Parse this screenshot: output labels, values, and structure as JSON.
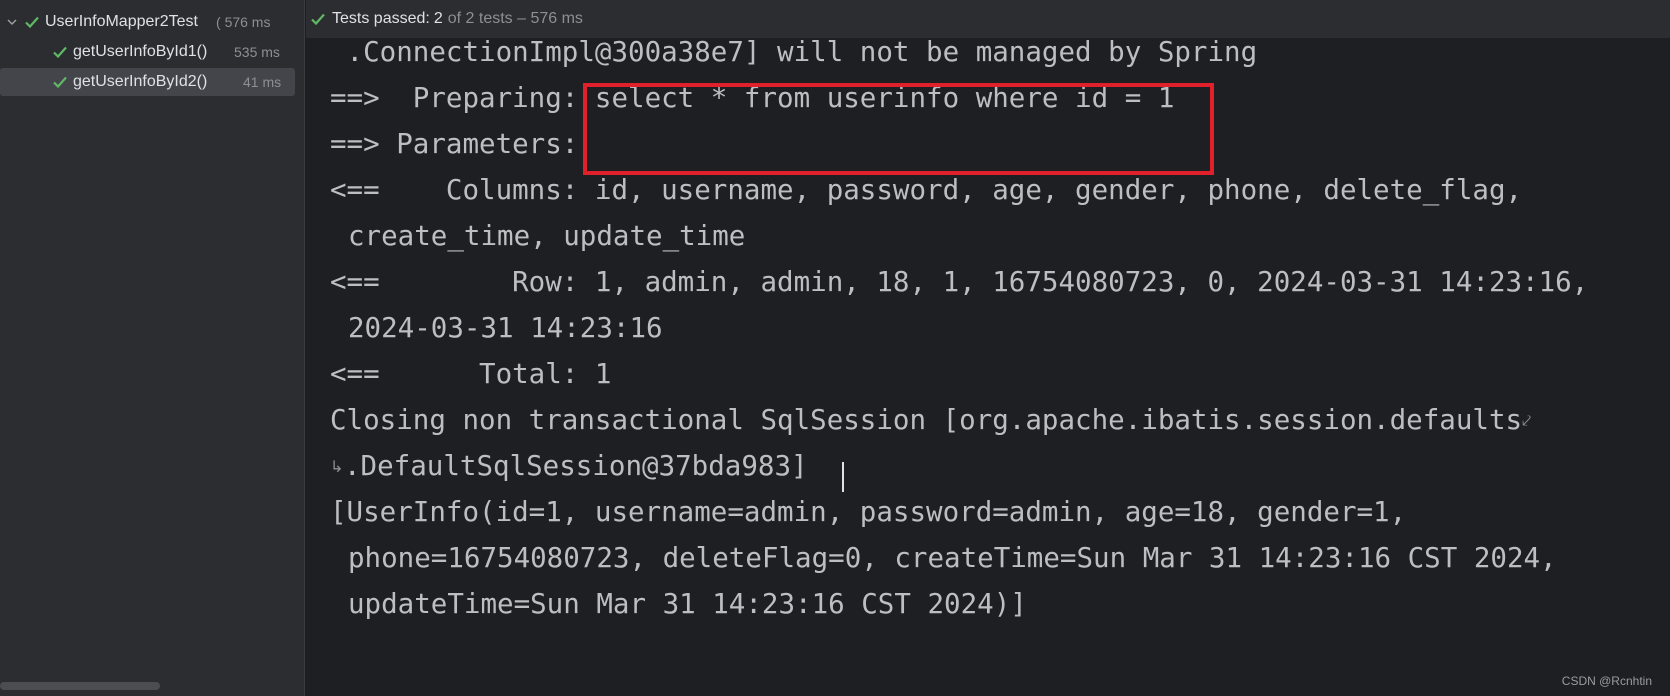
{
  "test_tree": {
    "root": {
      "name": "UserInfoMapper2Test",
      "time": "576 ms",
      "time_prefix": "("
    },
    "children": [
      {
        "name": "getUserInfoById1()",
        "time": "535 ms"
      },
      {
        "name": "getUserInfoById2()",
        "time": "41 ms"
      }
    ]
  },
  "status": {
    "label": "Tests passed:",
    "count": "2",
    "rest": "of 2 tests – 576 ms"
  },
  "console_lines": [
    " .ConnectionImpl@300a38e7] will not be managed by Spring",
    "==>  Preparing: select * from userinfo where id = 1",
    "==> Parameters: ",
    "<==    Columns: id, username, password, age, gender, phone, delete_flag,",
    "create_time, update_time",
    "<==        Row: 1, admin, admin, 18, 1, 16754080723, 0, 2024-03-31 14:23:16,",
    "2024-03-31 14:23:16",
    "<==      Total: 1",
    "Closing non transactional SqlSession [org.apache.ibatis.session.defaults",
    ".DefaultSqlSession@37bda983]",
    "[UserInfo(id=1, username=admin, password=admin, age=18, gender=1,",
    "phone=16754080723, deleteFlag=0, createTime=Sun Mar 31 14:23:16 CST 2024,",
    "updateTime=Sun Mar 31 14:23:16 CST 2024)]"
  ],
  "watermark": "CSDN @Rcnhtin",
  "icons": {
    "expand": "chevron-down-icon",
    "pass": "check-icon",
    "soft_wrap_end": "wrap-arrow-icon",
    "soft_wrap_start": "wrap-continue-icon"
  },
  "colors": {
    "pass_green": "#5fb865",
    "highlight_red": "#e0202a",
    "console_text": "#bcbec4"
  }
}
